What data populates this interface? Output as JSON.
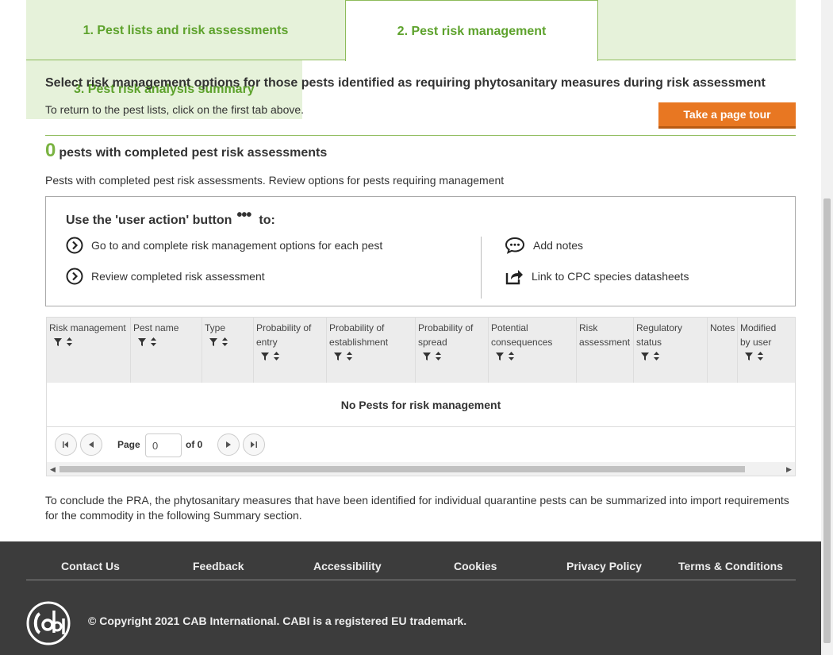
{
  "tabs": {
    "tab1": "1. Pest lists and risk assessments",
    "tab2": "2. Pest risk management",
    "tab3": "3. Pest risk analysis summary"
  },
  "heading": "Select risk management options for those pests identified as requiring phytosanitary measures during risk assessment",
  "subheading": "To return to the pest lists, click on the first tab above.",
  "tour_button": "Take a page tour",
  "pests_count": "0",
  "pests_count_label": "pests with completed pest risk assessments",
  "pests_subtext": "Pests with completed pest risk assessments. Review options for pests requiring management",
  "info_box": {
    "title_before": "Use the 'user action' button",
    "dots": "•••",
    "title_after": "to:",
    "items": [
      "Go to and complete risk management options for each pest",
      "Review completed risk assessment",
      "Add notes",
      "Link to CPC species datasheets"
    ]
  },
  "grid": {
    "columns": [
      "Risk management",
      "Pest name",
      "Type",
      "Probability of entry",
      "Probability of establishment",
      "Probability of spread",
      "Potential consequences",
      "Risk assessment",
      "Regulatory status",
      "Notes",
      "Modified by user"
    ],
    "empty_message": "No Pests for risk management",
    "pager": {
      "page_label": "Page",
      "page_value": "0",
      "of_label": "of 0"
    }
  },
  "conclude_text": "To conclude the PRA, the phytosanitary measures that have been identified for individual quarantine pests can be summarized into import requirements for the commodity in the following Summary section.",
  "footer": {
    "links": [
      "Contact Us",
      "Feedback",
      "Accessibility",
      "Cookies",
      "Privacy Policy",
      "Terms & Conditions"
    ],
    "copyright": "© Copyright 2021 CAB International. CABI is a registered EU trademark."
  },
  "colors": {
    "accent_green": "#5da22c",
    "tab_bg": "#e6f2da",
    "tour_orange": "#e87722",
    "footer_bg": "#3c3c3c"
  }
}
